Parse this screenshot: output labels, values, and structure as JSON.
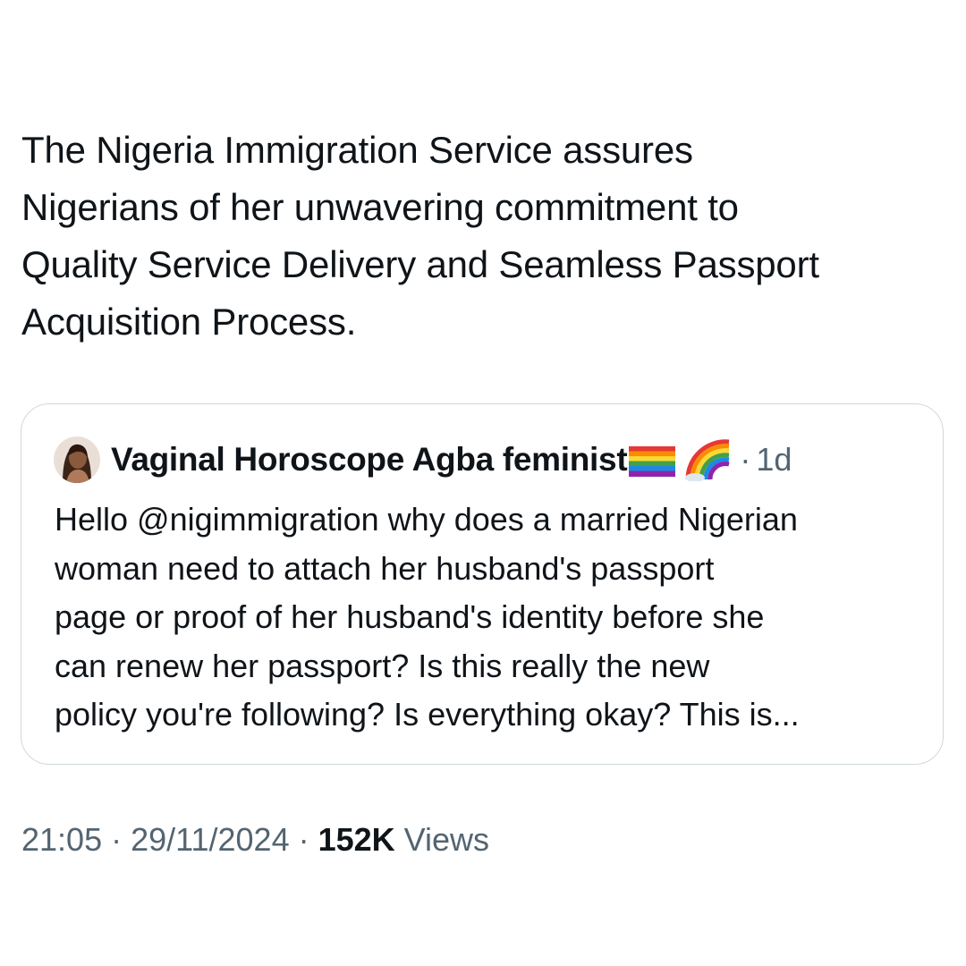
{
  "tweet": {
    "text_lines": [
      "The Nigeria Immigration Service assures",
      "Nigerians of her unwavering commitment to",
      "Quality Service Delivery and Seamless Passport",
      "Acquisition Process."
    ]
  },
  "quote": {
    "author_name": "Vaginal Horoscope Agba feminist",
    "icons": [
      "rainbow-flag-icon",
      "rainbow-icon"
    ],
    "dot": "·",
    "time": "1d",
    "text_lines": [
      "Hello @nigimmigration why does a married Nigerian",
      "woman need to attach her husband's passport",
      "page or proof of her husband's identity before she",
      "can renew her passport? Is this really the new",
      "policy you're following? Is everything okay? This is..."
    ]
  },
  "meta": {
    "time": "21:05",
    "dot1": " · ",
    "date": "29/11/2024",
    "dot2": " · ",
    "views_count": "152K",
    "views_label": " Views"
  },
  "colors": {
    "text_primary": "#0f1419",
    "text_secondary": "#536471",
    "border": "#cfd9de"
  }
}
